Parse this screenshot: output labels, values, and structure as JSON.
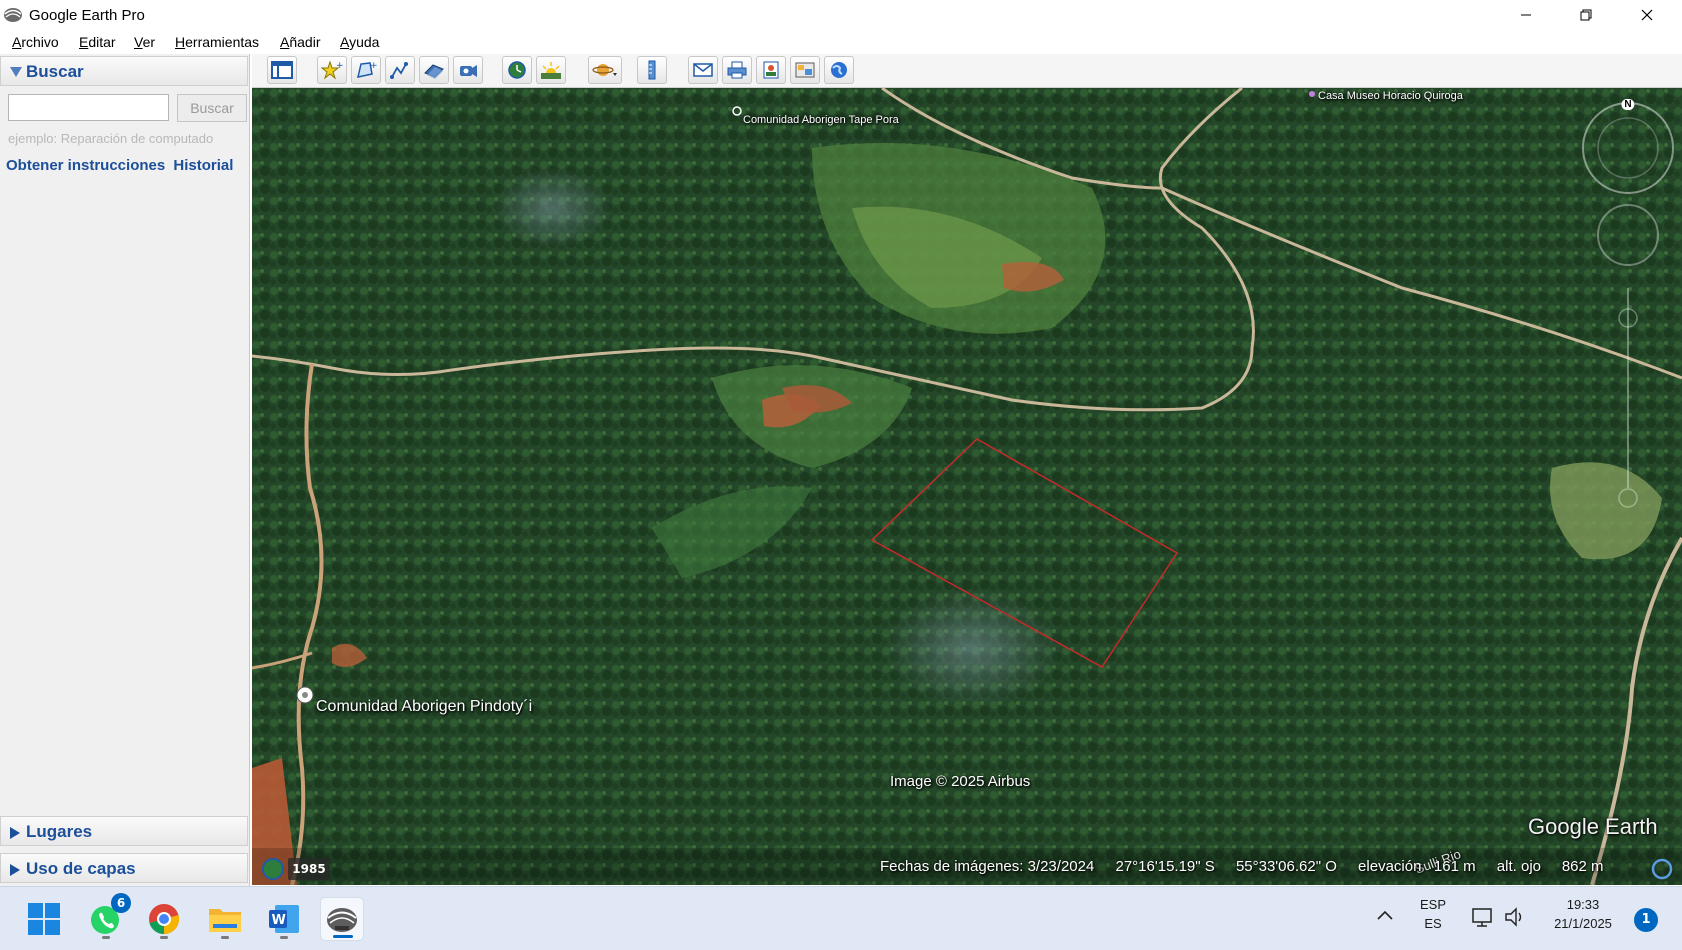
{
  "window": {
    "title": "Google Earth Pro"
  },
  "menu": {
    "items": [
      "Archivo",
      "Editar",
      "Ver",
      "Herramientas",
      "Añadir",
      "Ayuda"
    ]
  },
  "sidebar": {
    "search_panel_title": "Buscar",
    "search_input_value": "",
    "search_button_label": "Buscar",
    "search_hint": "ejemplo: Reparación de computado",
    "links": [
      "Obtener instrucciones",
      "Historial"
    ],
    "places_panel_title": "Lugares",
    "layers_panel_title": "Uso de capas"
  },
  "toolbar": {
    "icons": [
      "sidebar-toggle-icon",
      "placemark-icon",
      "polygon-icon",
      "path-icon",
      "image-overlay-icon",
      "record-tour-icon",
      "historical-imagery-icon",
      "sunlight-icon",
      "planets-icon",
      "ruler-icon",
      "email-icon",
      "print-icon",
      "save-image-icon",
      "view-in-maps-icon",
      "globe-icon"
    ]
  },
  "map": {
    "labels": {
      "community_top": "Comunidad Aborigen Tape Pora",
      "museum": "Casa Museo Horacio Quiroga",
      "community_main": "Comunidad Aborigen Pindoty´i",
      "copyright": "Image © 2025 Airbus",
      "logo": "Google Earth",
      "road_label": "Sulli Rio"
    },
    "compass_label": "N",
    "historical_year": "1985",
    "status": {
      "image_date": "Fechas de imágenes: 3/23/2024",
      "latitude": "27°16'15.19\" S",
      "longitude": "55°33'06.62\" O",
      "elevation": "elevación   161 m",
      "eye_altitude": "alt. ojo     862 m"
    },
    "colors": {
      "forest_dark": "#1d3a1f",
      "forest_mid": "#2c5a2a",
      "clearing": "#6e9a4a",
      "road": "#c9b79a",
      "soil": "#b5603a",
      "polygon": "#c62a2a"
    }
  },
  "taskbar": {
    "whatsapp_badge": "6",
    "language_top": "ESP",
    "language_bottom": "ES",
    "time": "19:33",
    "date": "21/1/2025",
    "notification_count": "1",
    "accent": "#0067c0"
  }
}
